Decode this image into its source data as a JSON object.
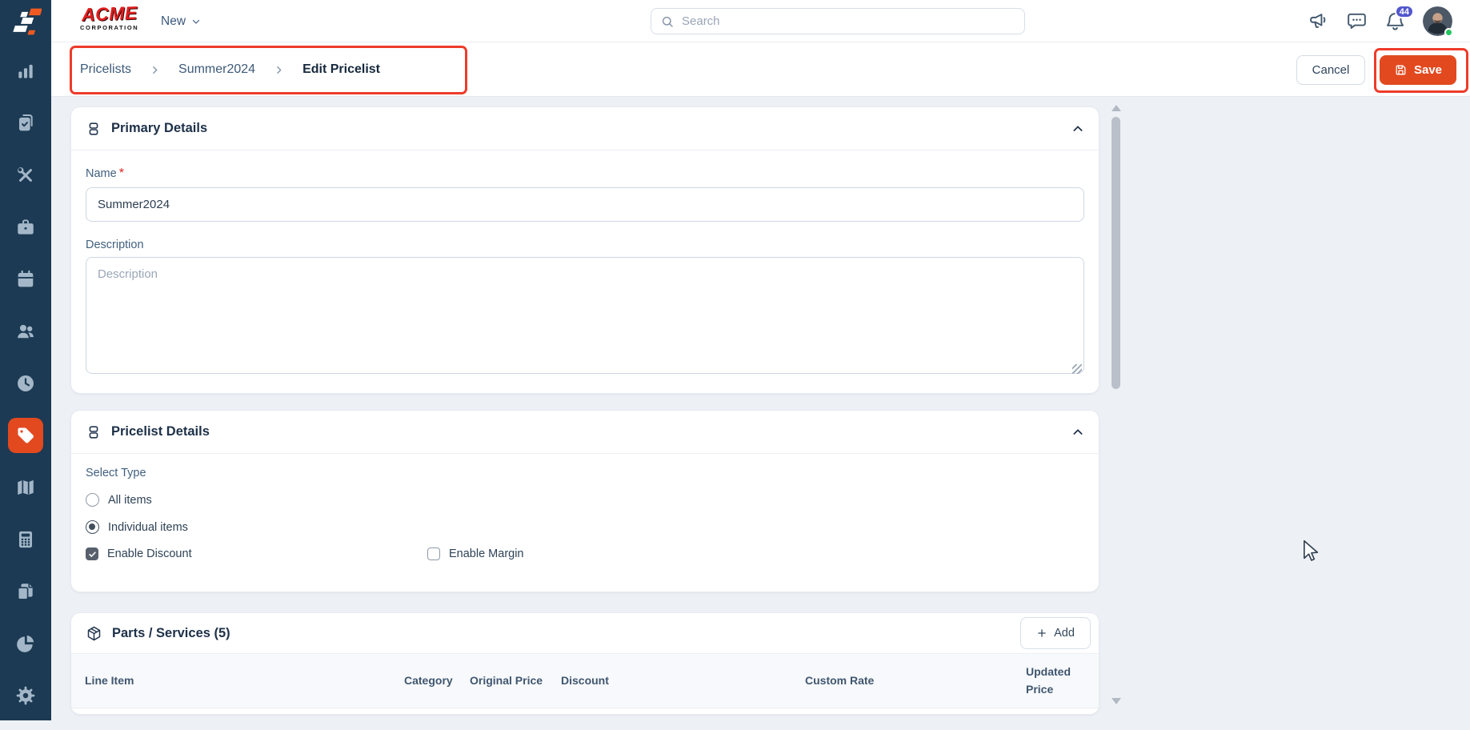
{
  "topbar": {
    "brand_line1": "ACME",
    "brand_line2": "CORPORATION",
    "new_label": "New",
    "search_placeholder": "Search",
    "notification_count": "44"
  },
  "sidebar": {
    "items": [
      {
        "icon": "bar-chart-icon",
        "active": false
      },
      {
        "icon": "clipboard-check-icon",
        "active": false
      },
      {
        "icon": "tools-icon",
        "active": false
      },
      {
        "icon": "briefcase-icon",
        "active": false
      },
      {
        "icon": "calendar-icon",
        "active": false
      },
      {
        "icon": "users-icon",
        "active": false
      },
      {
        "icon": "clock-icon",
        "active": false
      },
      {
        "icon": "tag-icon",
        "active": true
      },
      {
        "icon": "map-icon",
        "active": false
      },
      {
        "icon": "calculator-icon",
        "active": false
      },
      {
        "icon": "copy-icon",
        "active": false
      },
      {
        "icon": "pie-chart-icon",
        "active": false
      },
      {
        "icon": "gear-icon",
        "active": false
      }
    ]
  },
  "breadcrumb": {
    "items": [
      "Pricelists",
      "Summer2024",
      "Edit Pricelist"
    ]
  },
  "actions": {
    "cancel_label": "Cancel",
    "save_label": "Save"
  },
  "primary_details": {
    "title": "Primary Details",
    "name_label": "Name",
    "required_mark": "*",
    "name_value": "Summer2024",
    "description_label": "Description",
    "description_placeholder": "Description"
  },
  "pricelist_details": {
    "title": "Pricelist Details",
    "select_type_label": "Select Type",
    "radio_options": [
      {
        "label": "All items",
        "selected": false
      },
      {
        "label": "Individual items",
        "selected": true
      }
    ],
    "checkbox_options": [
      {
        "label": "Enable Discount",
        "checked": true
      },
      {
        "label": "Enable Margin",
        "checked": false
      }
    ]
  },
  "parts_services": {
    "title": "Parts / Services (5)",
    "add_label": "Add",
    "columns": [
      "Line Item",
      "Category",
      "Original Price",
      "Discount",
      "Custom Rate",
      "Updated Price"
    ]
  },
  "colors": {
    "accent_orange": "#E2491F",
    "annotation_red": "#EE3B2A",
    "sidebar_navy": "#1C3A53",
    "badge_indigo": "#5257CD",
    "status_green": "#22C55E",
    "brand_red": "#E01E1E"
  }
}
